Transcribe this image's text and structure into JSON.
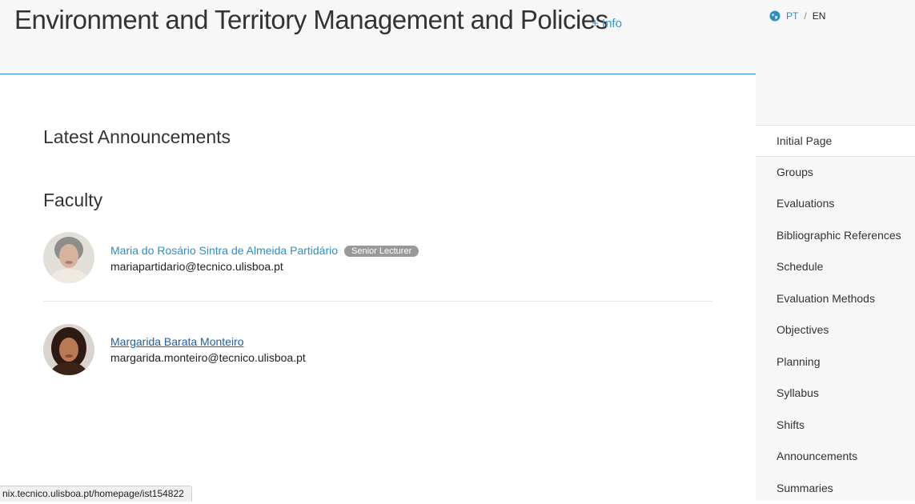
{
  "header": {
    "title": "Environment and Territory Management and Policies",
    "info_link": "+ Info"
  },
  "language": {
    "pt": "PT",
    "separator": "/",
    "en": "EN"
  },
  "main": {
    "latest_announcements_heading": "Latest Announcements",
    "faculty_heading": "Faculty",
    "faculty": [
      {
        "name": "Maria do Rosário Sintra de Almeida Partidário",
        "role": "Senior Lecturer",
        "email": "mariapartidario@tecnico.ulisboa.pt"
      },
      {
        "name": "Margarida Barata Monteiro",
        "email": "margarida.monteiro@tecnico.ulisboa.pt"
      }
    ]
  },
  "sidebar": {
    "items": [
      {
        "label": "Initial Page",
        "active": true
      },
      {
        "label": "Groups"
      },
      {
        "label": "Evaluations"
      },
      {
        "label": "Bibliographic References"
      },
      {
        "label": "Schedule"
      },
      {
        "label": "Evaluation Methods"
      },
      {
        "label": "Objectives"
      },
      {
        "label": "Planning"
      },
      {
        "label": "Syllabus"
      },
      {
        "label": "Shifts"
      },
      {
        "label": "Announcements"
      },
      {
        "label": "Summaries"
      }
    ]
  },
  "status_bar": {
    "url": "nix.tecnico.ulisboa.pt/homepage/ist154822"
  },
  "colors": {
    "accent": "#2a8fc4",
    "link": "#3a95cc",
    "badge": "#999999"
  }
}
